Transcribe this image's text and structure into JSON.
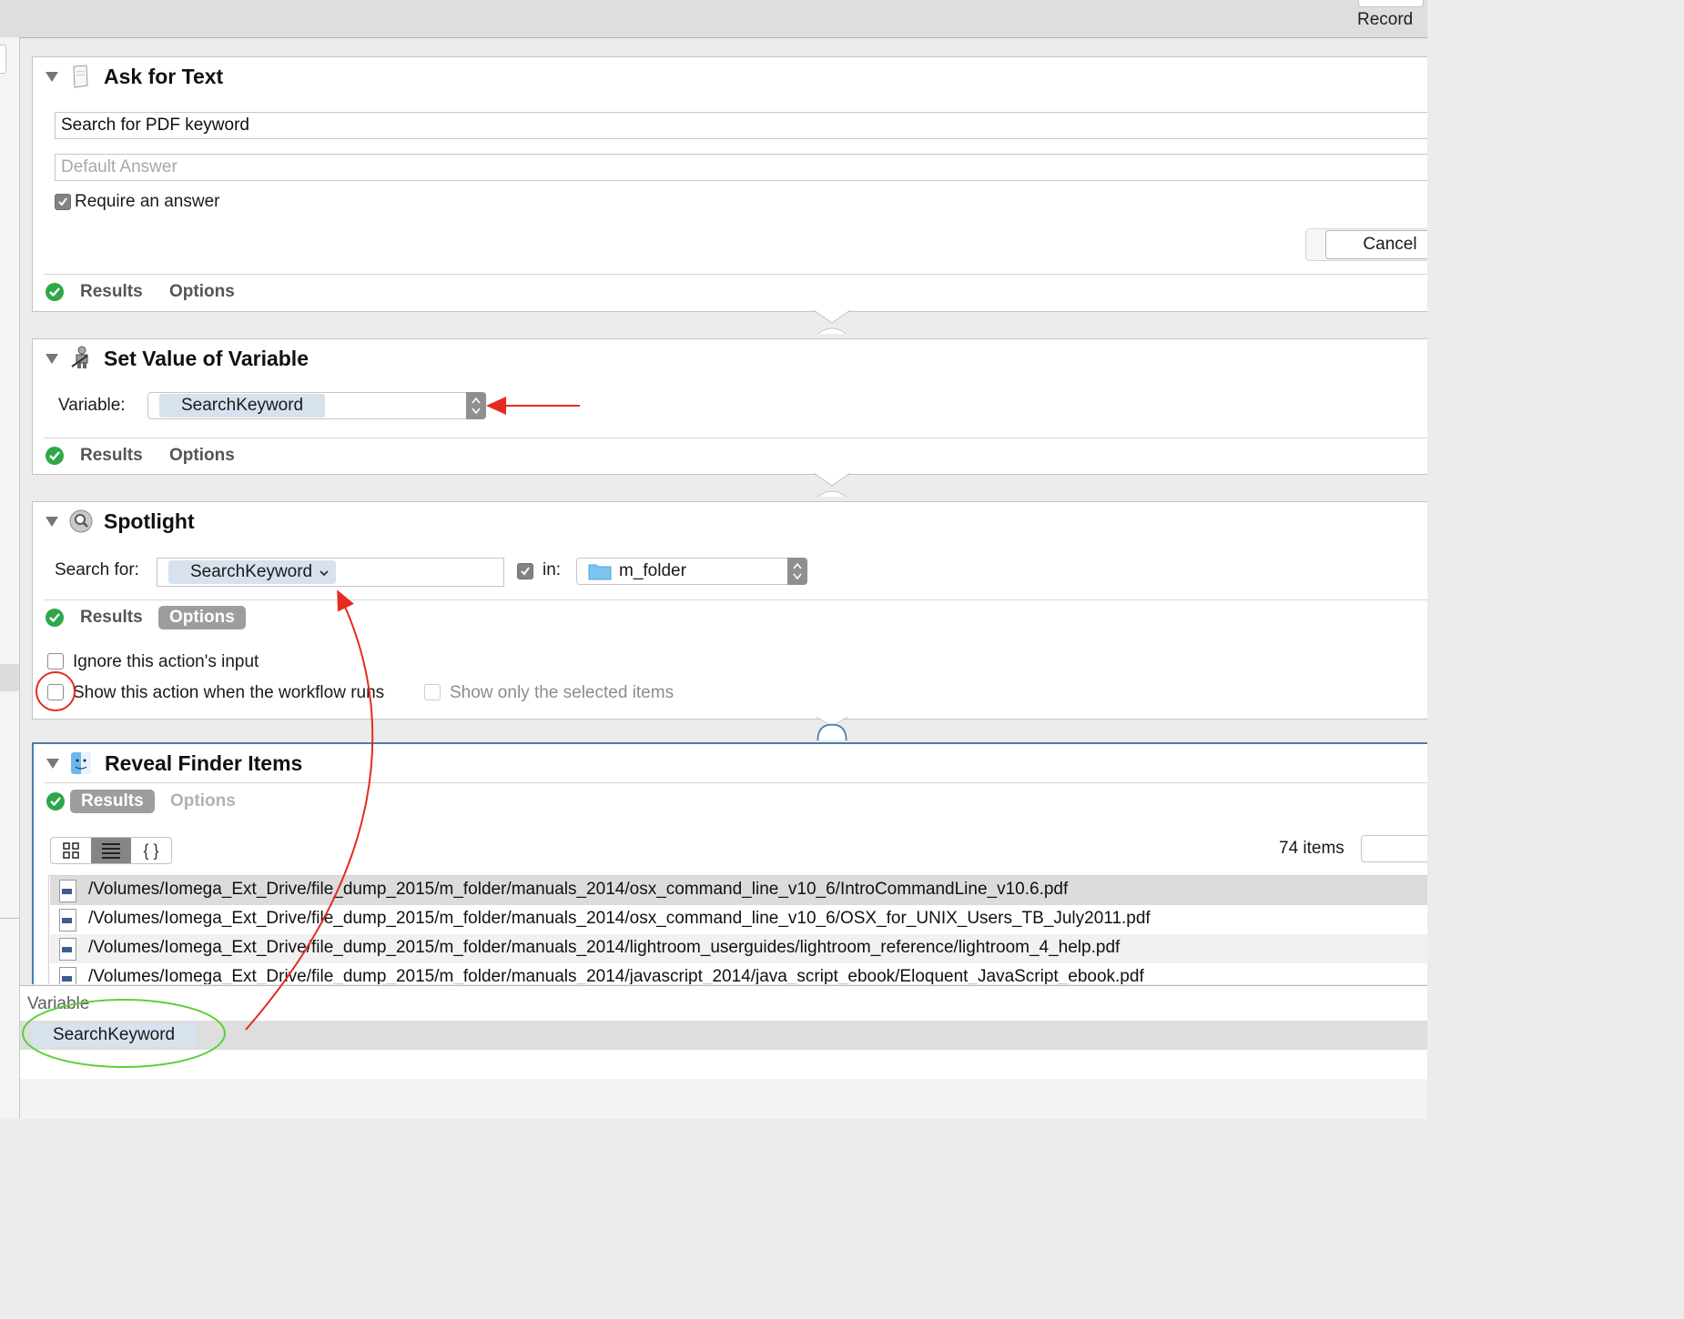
{
  "toolbar": {
    "record_label": "Record"
  },
  "actions": {
    "ask_for_text": {
      "title": "Ask for Text",
      "question": "Search for PDF keyword",
      "default_answer_placeholder": "Default Answer",
      "require_answer_label": "Require an answer",
      "require_answer_checked": true,
      "cancel_label": "Cancel",
      "results_tab": "Results",
      "options_tab": "Options"
    },
    "set_value_of_variable": {
      "title": "Set Value of Variable",
      "variable_label": "Variable:",
      "variable_value": "SearchKeyword",
      "results_tab": "Results",
      "options_tab": "Options"
    },
    "spotlight": {
      "title": "Spotlight",
      "search_for_label": "Search for:",
      "search_token": "SearchKeyword",
      "in_label": "in:",
      "in_checked": true,
      "folder_value": "m_folder",
      "results_tab": "Results",
      "options_tab": "Options",
      "ignore_input_label": "Ignore this action's input",
      "show_action_label": "Show this action when the workflow runs",
      "show_selected_label": "Show only the selected items"
    },
    "reveal_finder_items": {
      "title": "Reveal Finder Items",
      "results_tab": "Results",
      "options_tab": "Options",
      "item_count": "74 items",
      "view_icons": [
        "grid-view-icon",
        "list-view-icon",
        "json-view-icon"
      ],
      "json_view_glyph": "{ }",
      "files": [
        "/Volumes/Iomega_Ext_Drive/file_dump_2015/m_folder/manuals_2014/osx_command_line_v10_6/IntroCommandLine_v10.6.pdf",
        "/Volumes/Iomega_Ext_Drive/file_dump_2015/m_folder/manuals_2014/osx_command_line_v10_6/OSX_for_UNIX_Users_TB_July2011.pdf",
        "/Volumes/Iomega_Ext_Drive/file_dump_2015/m_folder/manuals_2014/lightroom_userguides/lightroom_reference/lightroom_4_help.pdf",
        "/Volumes/Iomega_Ext_Drive/file_dump_2015/m_folder/manuals_2014/javascript_2014/java_script_ebook/Eloquent_JavaScript_ebook.pdf"
      ]
    }
  },
  "variables_panel": {
    "header": "Variable",
    "items": [
      "SearchKeyword"
    ]
  },
  "colors": {
    "accent_selected_border": "#4a7dae",
    "success_green": "#2fa84a",
    "annotation_red": "#e32b1f",
    "annotation_green": "#5ad23a",
    "token_bg": "#d7e2ee"
  }
}
